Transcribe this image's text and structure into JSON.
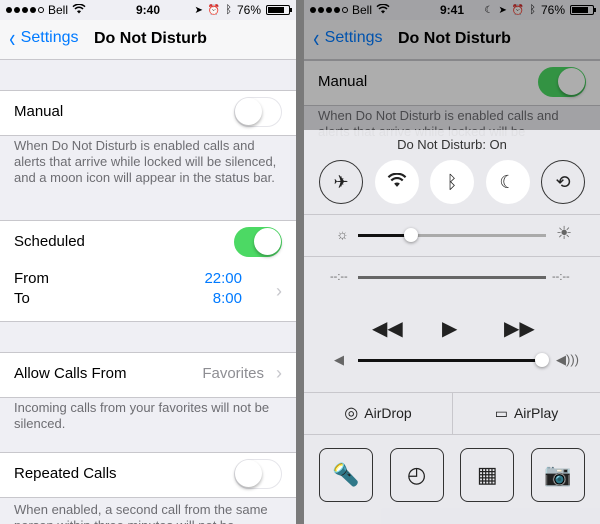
{
  "left": {
    "status": {
      "carrier": "Bell",
      "time": "9:40",
      "battery": "76%",
      "battery_level": 0.76
    },
    "nav": {
      "back_label": "Settings",
      "title": "Do Not Disturb"
    },
    "manual": {
      "label": "Manual",
      "on": false
    },
    "manual_footer": "When Do Not Disturb is enabled calls and alerts that arrive while locked will be silenced, and a moon icon will appear in the status bar.",
    "scheduled": {
      "label": "Scheduled",
      "on": true,
      "from_label": "From",
      "to_label": "To",
      "from_time": "22:00",
      "to_time": "8:00"
    },
    "allow_calls": {
      "label": "Allow Calls From",
      "value": "Favorites"
    },
    "allow_footer": "Incoming calls from your favorites will not be silenced.",
    "repeated": {
      "label": "Repeated Calls",
      "on": false
    },
    "repeated_footer": "When enabled, a second call from the same person within three minutes will not be"
  },
  "right": {
    "status": {
      "carrier": "Bell",
      "time": "9:41",
      "battery": "76%",
      "battery_level": 0.76
    },
    "nav": {
      "back_label": "Settings",
      "title": "Do Not Disturb"
    },
    "manual": {
      "label": "Manual",
      "on": true
    },
    "manual_footer": "When Do Not Disturb is enabled calls and alerts that arrive while locked will be",
    "control_center": {
      "header": "Do Not Disturb: On",
      "brightness": 0.28,
      "elapsed": "--:--",
      "remaining": "--:--",
      "volume": 0.98,
      "airdrop_label": "AirDrop",
      "airplay_label": "AirPlay"
    }
  }
}
